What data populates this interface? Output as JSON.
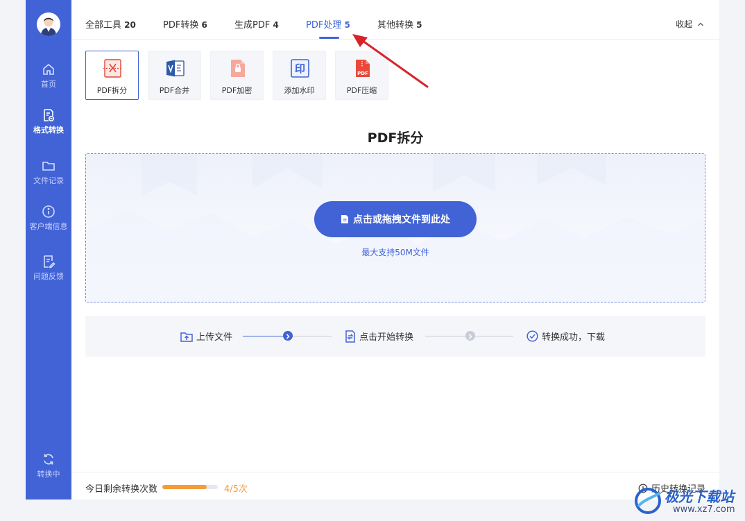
{
  "sidebar": {
    "items": [
      {
        "label": "首页",
        "icon": "home-icon"
      },
      {
        "label": "格式转换",
        "icon": "format-convert-icon"
      },
      {
        "label": "文件记录",
        "icon": "folder-icon"
      },
      {
        "label": "客户端信息",
        "icon": "info-icon"
      },
      {
        "label": "问题反馈",
        "icon": "feedback-icon"
      }
    ],
    "bottom": {
      "label": "转换中",
      "icon": "refresh-icon"
    }
  },
  "tabs": [
    {
      "label": "全部工具",
      "count": "20"
    },
    {
      "label": "PDF转换",
      "count": "6"
    },
    {
      "label": "生成PDF",
      "count": "4"
    },
    {
      "label": "PDF处理",
      "count": "5"
    },
    {
      "label": "其他转换",
      "count": "5"
    }
  ],
  "collapse_label": "收起",
  "tools": [
    {
      "label": "PDF拆分",
      "icon": "pdf-split-icon"
    },
    {
      "label": "PDF合并",
      "icon": "pdf-merge-icon"
    },
    {
      "label": "PDF加密",
      "icon": "pdf-lock-icon"
    },
    {
      "label": "添加水印",
      "icon": "watermark-icon",
      "glyph": "印"
    },
    {
      "label": "PDF压缩",
      "icon": "pdf-compress-icon",
      "glyph": "PDF"
    }
  ],
  "section_title": "PDF拆分",
  "dropzone": {
    "button_label": "点击或拖拽文件到此处",
    "hint": "最大支持50M文件"
  },
  "steps": [
    {
      "label": "上传文件"
    },
    {
      "label": "点击开始转换"
    },
    {
      "label": "转换成功，下载"
    }
  ],
  "footer": {
    "remaining_label": "今日剩余转换次数",
    "remaining_count": "4/5次",
    "remaining_fraction": 0.8,
    "history_label": "历史转换记录"
  },
  "watermark": {
    "brand": "极光下载站",
    "url": "www.xz7.com"
  },
  "colors": {
    "primary": "#4163d6",
    "orange": "#f59b3a",
    "arrow": "#d9232b"
  }
}
